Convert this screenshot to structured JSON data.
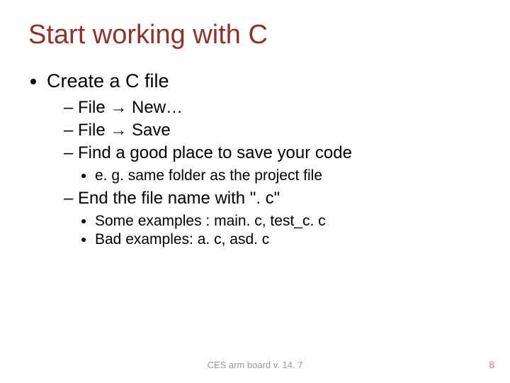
{
  "title": "Start working with C",
  "bullets": {
    "b1": "Create a C file",
    "s1": "File ",
    "s1b": " New…",
    "s2": "File ",
    "s2b": " Save",
    "s3": "Find a good place to save your code",
    "s3a": "e. g. same folder as the project file",
    "s4": "End the file name with \". c\"",
    "s4a": "Some examples : main. c, test_c. c",
    "s4b": "Bad examples: a. c, asd. c"
  },
  "arrow": "→",
  "footer": {
    "center": "CES arm board v. 14. 7",
    "page": "8"
  }
}
